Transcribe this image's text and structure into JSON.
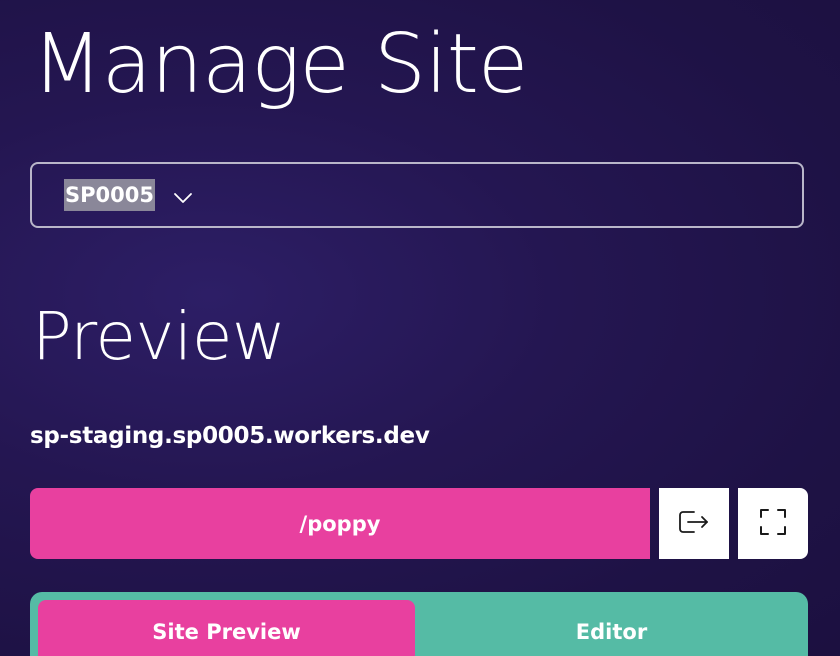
{
  "header": {
    "title": "Manage Site"
  },
  "site_select": {
    "selected": "SP0005",
    "icon": "chevron-down-icon"
  },
  "preview": {
    "title": "Preview",
    "url": "sp-staging.sp0005.workers.dev",
    "path_label": "/poppy",
    "open_icon": "open-external-icon",
    "fullscreen_icon": "fullscreen-icon"
  },
  "tabs": [
    {
      "label": "Site Preview",
      "active": true
    },
    {
      "label": "Editor",
      "active": false
    }
  ],
  "colors": {
    "background": "#241651",
    "accent_pink": "#e8409f",
    "accent_teal": "#55bba5",
    "select_border": "#b9b6c9"
  }
}
